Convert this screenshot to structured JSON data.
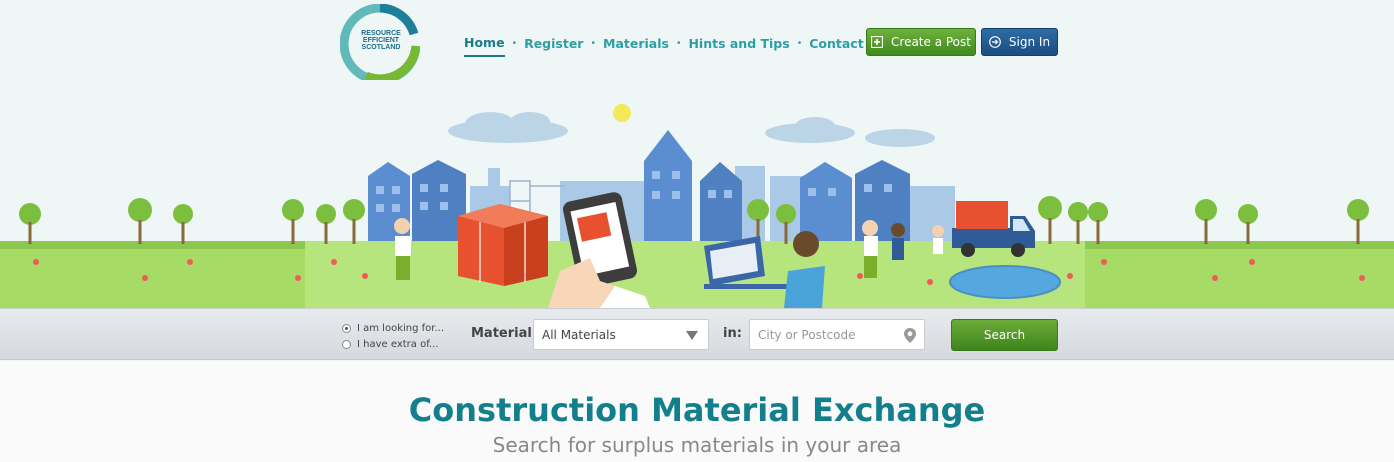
{
  "logo": {
    "text_lines": [
      "RESOURCE",
      "EFFICIENT",
      "SCOTLAND"
    ]
  },
  "nav": {
    "items": [
      "Home",
      "Register",
      "Materials",
      "Hints and Tips",
      "Contact"
    ],
    "separator": "•"
  },
  "header_buttons": {
    "create_post": "Create a Post",
    "sign_in": "Sign In"
  },
  "search": {
    "mode_options": [
      "I am looking for...",
      "I have extra of..."
    ],
    "material_label": "Material:",
    "material_value": "All Materials",
    "location_label": "in:",
    "location_placeholder": "City or Postcode",
    "submit": "Search"
  },
  "main": {
    "title": "Construction Material Exchange",
    "subtitle": "Search for surplus materials in your area"
  },
  "colors": {
    "accent_teal": "#147f8c",
    "green": "#4f9a28",
    "blue": "#1f5a92"
  }
}
